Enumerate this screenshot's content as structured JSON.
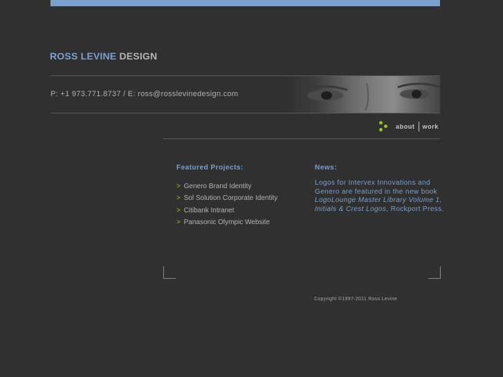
{
  "brand": {
    "name_part1": "ROSS LEVINE",
    "name_part2": "DESIGN"
  },
  "contact": {
    "text": "P: +1 973.771.8737 / E: ross@rosslevinedesign.com"
  },
  "nav": {
    "about": "about",
    "work": "work"
  },
  "featured": {
    "title": "Featured Projects:",
    "marker": ">",
    "items": [
      "Genero Brand Identity",
      "Sol Solution Corporate Identity",
      "Citibank Intranet",
      "Panasonic Olympic Website"
    ]
  },
  "news": {
    "title": "News:",
    "line1": "Logos for Intervex Innovations and Genero are featured in the new book ",
    "book_title": "LogoLounge Master Library Volume 1, Initials & Crest Logos",
    "line2": ", Rockport Press."
  },
  "footer": {
    "copyright": "Copyright ©1997-2011 Ross Levine"
  },
  "colors": {
    "accent_blue": "#7aa0cc",
    "accent_green": "#9bc21a",
    "background": "#303030"
  }
}
